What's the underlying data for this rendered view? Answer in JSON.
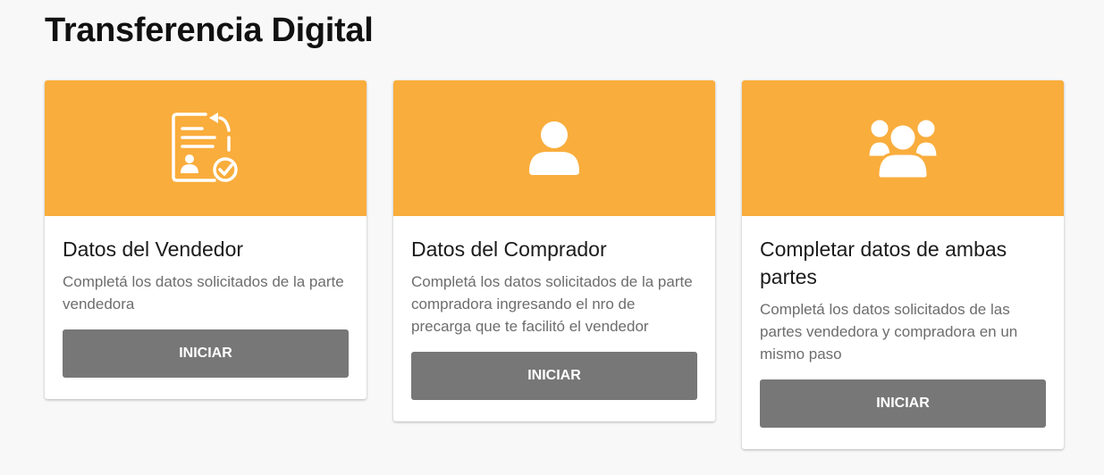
{
  "page": {
    "title": "Transferencia Digital"
  },
  "colors": {
    "accent": "#f9ad3c",
    "button": "#777777"
  },
  "cards": [
    {
      "icon": "document-form-check-icon",
      "title": "Datos del Vendedor",
      "description": "Completá los datos solicitados de la parte vendedora",
      "button_label": "INICIAR"
    },
    {
      "icon": "user-icon",
      "title": "Datos del Comprador",
      "description": "Completá los datos solicitados de la parte compradora ingresando el nro de precarga que te facilitó el vendedor",
      "button_label": "INICIAR"
    },
    {
      "icon": "users-group-icon",
      "title": "Completar datos de ambas partes",
      "description": "Completá los datos solicitados de las partes vendedora y compradora en un mismo paso",
      "button_label": "INICIAR"
    }
  ]
}
